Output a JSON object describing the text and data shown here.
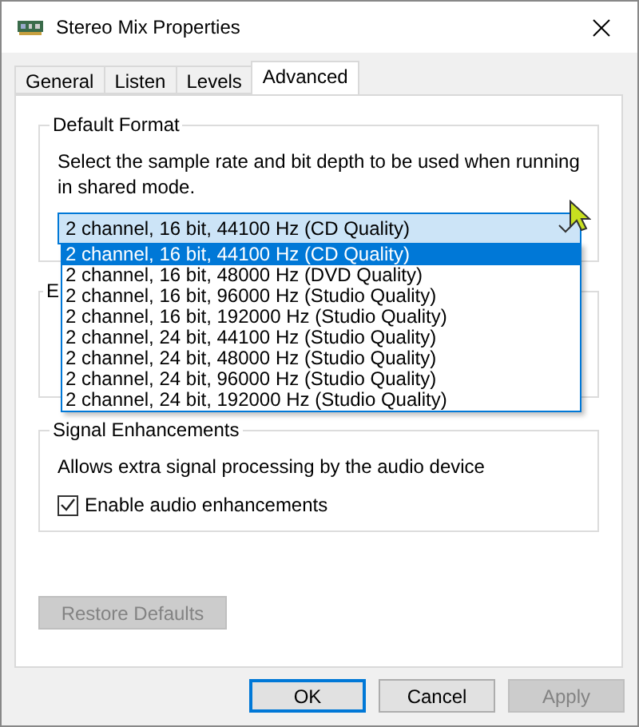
{
  "window": {
    "title": "Stereo Mix Properties"
  },
  "tabs": [
    {
      "label": "General",
      "selected": false
    },
    {
      "label": "Listen",
      "selected": false
    },
    {
      "label": "Levels",
      "selected": false
    },
    {
      "label": "Advanced",
      "selected": true
    }
  ],
  "default_format": {
    "title": "Default Format",
    "description": "Select the sample rate and bit depth to be used when running in shared mode.",
    "select": {
      "value": "2 channel, 16 bit, 44100 Hz (CD Quality)",
      "expanded": true
    },
    "options": [
      {
        "label": "2 channel, 16 bit, 44100 Hz (CD Quality)",
        "selected": true
      },
      {
        "label": "2 channel, 16 bit, 48000 Hz (DVD Quality)",
        "selected": false
      },
      {
        "label": "2 channel, 16 bit, 96000 Hz (Studio Quality)",
        "selected": false
      },
      {
        "label": "2 channel, 16 bit, 192000 Hz (Studio Quality)",
        "selected": false
      },
      {
        "label": "2 channel, 24 bit, 44100 Hz (Studio Quality)",
        "selected": false
      },
      {
        "label": "2 channel, 24 bit, 48000 Hz (Studio Quality)",
        "selected": false
      },
      {
        "label": "2 channel, 24 bit, 96000 Hz (Studio Quality)",
        "selected": false
      },
      {
        "label": "2 channel, 24 bit, 192000 Hz (Studio Quality)",
        "selected": false
      }
    ]
  },
  "exclusive_group": {
    "title": "E"
  },
  "signal_enhancements": {
    "title": "Signal Enhancements",
    "description": "Allows extra signal processing by the audio device",
    "checkbox": {
      "label": "Enable audio enhancements",
      "checked": true
    }
  },
  "restore_button": {
    "label": "Restore Defaults",
    "disabled": true
  },
  "buttons": [
    {
      "label": "OK",
      "kind": "default"
    },
    {
      "label": "Cancel",
      "kind": "normal"
    },
    {
      "label": "Apply",
      "kind": "disabled"
    }
  ]
}
